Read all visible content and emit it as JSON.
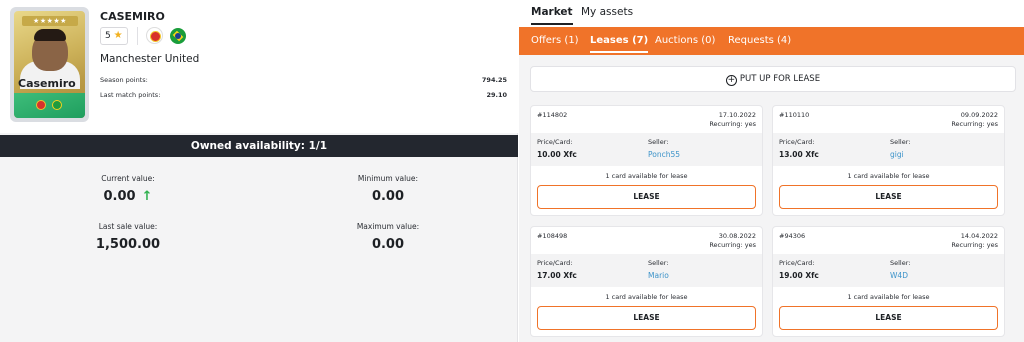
{
  "player": {
    "name": "CASEMIRO",
    "card_name": "Casemiro",
    "card_stars": "★★★★★",
    "stars": "5",
    "club": "Manchester United",
    "season_points_label": "Season points:",
    "season_points": "794.25",
    "last_match_label": "Last match points:",
    "last_match": "29.10"
  },
  "availability": "Owned availability:  1/1",
  "values": {
    "current_label": "Current value:",
    "current": "0.00",
    "minimum_label": "Minimum value:",
    "minimum": "0.00",
    "last_sale_label": "Last sale value:",
    "last_sale": "1,500.00",
    "maximum_label": "Maximum value:",
    "maximum": "0.00"
  },
  "tabs": {
    "market": "Market",
    "my_assets": "My assets"
  },
  "subtabs": {
    "offers": "Offers (1)",
    "leases": "Leases (7)",
    "auctions": "Auctions (0)",
    "requests": "Requests (4)"
  },
  "put_up_label": "PUT UP FOR LEASE",
  "labels": {
    "price": "Price/Card:",
    "seller": "Seller:",
    "available": "1 card available for lease",
    "recurring": "Recurring: yes",
    "lease_button": "LEASE"
  },
  "leases": [
    {
      "id": "#114802",
      "date": "17.10.2022",
      "price": "10.00 Xfc",
      "seller": "Ponch55"
    },
    {
      "id": "#110110",
      "date": "09.09.2022",
      "price": "13.00 Xfc",
      "seller": "gigi"
    },
    {
      "id": "#108498",
      "date": "30.08.2022",
      "price": "17.00 Xfc",
      "seller": "Mario"
    },
    {
      "id": "#94306",
      "date": "14.04.2022",
      "price": "19.00 Xfc",
      "seller": "W4D"
    }
  ],
  "colors": {
    "accent": "#f07329",
    "dark_bar": "#23272f",
    "link": "#3c93c9",
    "up_arrow": "#2fb14e"
  }
}
